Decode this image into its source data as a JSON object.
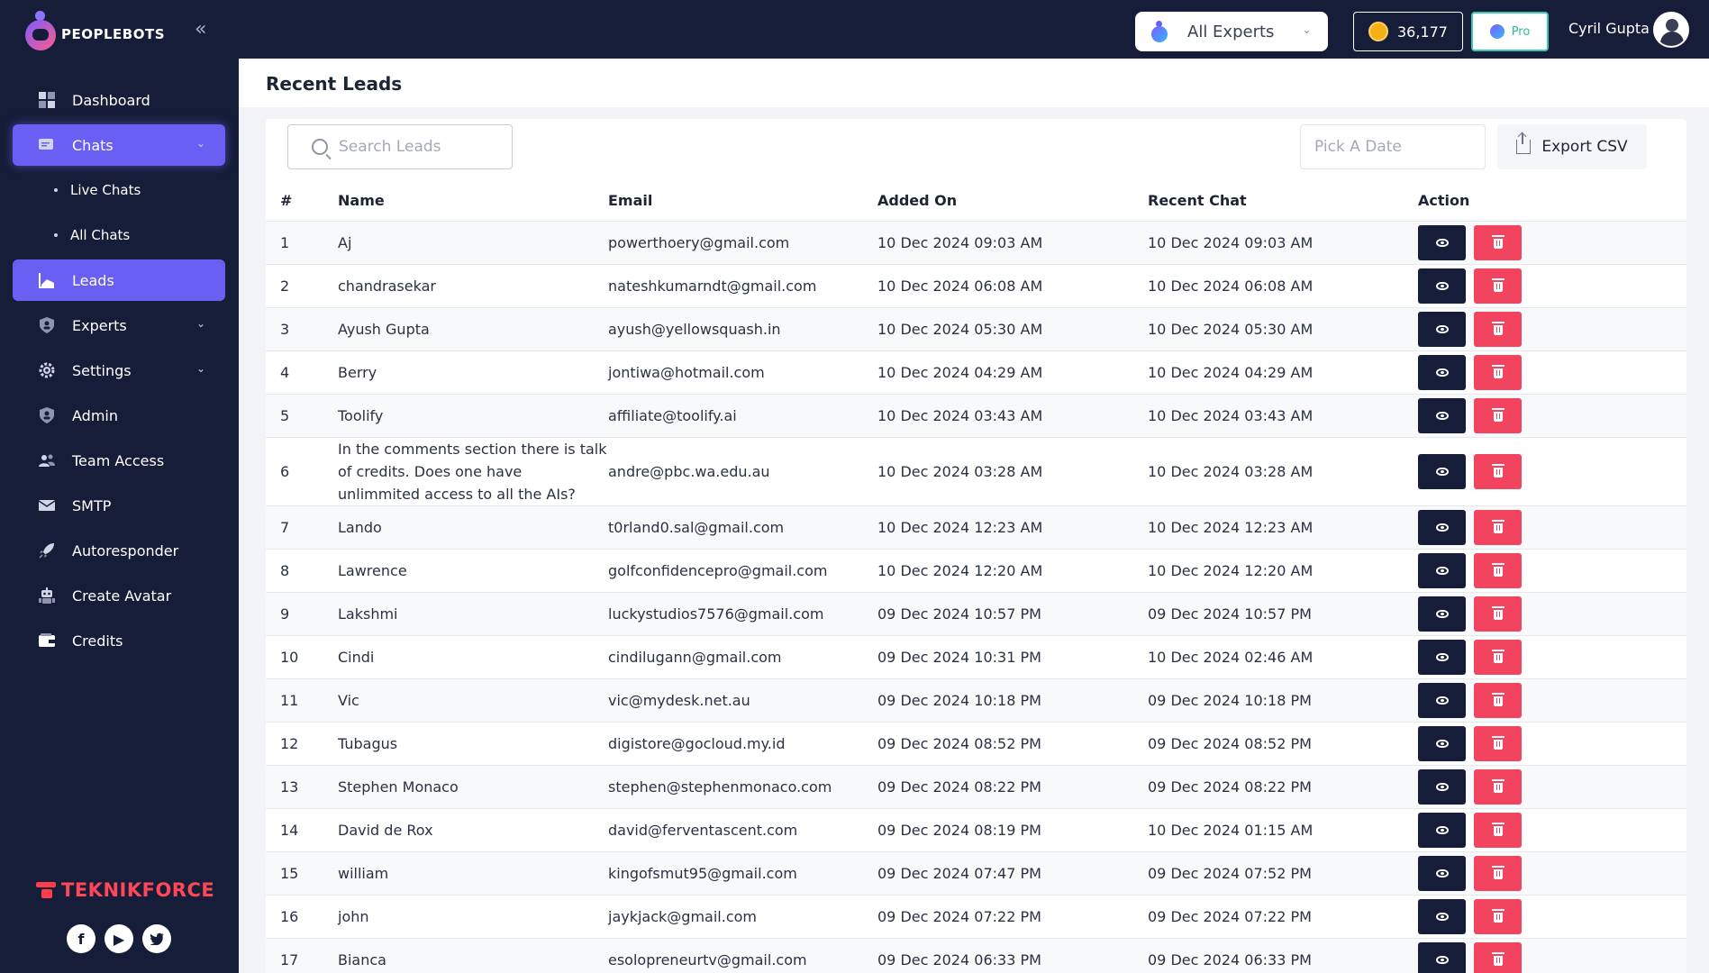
{
  "app": {
    "logo_text": "PEOPLEBOTS",
    "brand_footer": "TEKNIKFORCE"
  },
  "sidebar": {
    "items": [
      {
        "label": "Dashboard"
      },
      {
        "label": "Chats"
      },
      {
        "label": "Live Chats"
      },
      {
        "label": "All Chats"
      },
      {
        "label": "Leads"
      },
      {
        "label": "Experts"
      },
      {
        "label": "Settings"
      },
      {
        "label": "Admin"
      },
      {
        "label": "Team Access"
      },
      {
        "label": "SMTP"
      },
      {
        "label": "Autoresponder"
      },
      {
        "label": "Create Avatar"
      },
      {
        "label": "Credits"
      }
    ]
  },
  "header": {
    "experts_select": "All Experts",
    "credits": "36,177",
    "plan": "Pro",
    "user_name": "Cyril Gupta"
  },
  "main": {
    "page_title": "Recent Leads",
    "search_placeholder": "Search Leads",
    "date_placeholder": "Pick A Date",
    "export_label": "Export CSV",
    "columns": [
      "#",
      "Name",
      "Email",
      "Added On",
      "Recent Chat",
      "Action"
    ],
    "rows": [
      {
        "n": "1",
        "name": "Aj",
        "email": "powerthoery@gmail.com",
        "added": "10 Dec 2024 09:03 AM",
        "recent": "10 Dec 2024 09:03 AM"
      },
      {
        "n": "2",
        "name": "chandrasekar",
        "email": "nateshkumarndt@gmail.com",
        "added": "10 Dec 2024 06:08 AM",
        "recent": "10 Dec 2024 06:08 AM"
      },
      {
        "n": "3",
        "name": "Ayush Gupta",
        "email": "ayush@yellowsquash.in",
        "added": "10 Dec 2024 05:30 AM",
        "recent": "10 Dec 2024 05:30 AM"
      },
      {
        "n": "4",
        "name": "Berry",
        "email": "jontiwa@hotmail.com",
        "added": "10 Dec 2024 04:29 AM",
        "recent": "10 Dec 2024 04:29 AM"
      },
      {
        "n": "5",
        "name": "Toolify",
        "email": "affiliate@toolify.ai",
        "added": "10 Dec 2024 03:43 AM",
        "recent": "10 Dec 2024 03:43 AM"
      },
      {
        "n": "6",
        "name": "In the comments section there is talk of credits. Does one have unlimmited access to all the AIs?",
        "email": "andre@pbc.wa.edu.au",
        "added": "10 Dec 2024 03:28 AM",
        "recent": "10 Dec 2024 03:28 AM"
      },
      {
        "n": "7",
        "name": "Lando",
        "email": "t0rland0.sal@gmail.com",
        "added": "10 Dec 2024 12:23 AM",
        "recent": "10 Dec 2024 12:23 AM"
      },
      {
        "n": "8",
        "name": "Lawrence",
        "email": "golfconfidencepro@gmail.com",
        "added": "10 Dec 2024 12:20 AM",
        "recent": "10 Dec 2024 12:20 AM"
      },
      {
        "n": "9",
        "name": "Lakshmi",
        "email": "luckystudios7576@gmail.com",
        "added": "09 Dec 2024 10:57 PM",
        "recent": "09 Dec 2024 10:57 PM"
      },
      {
        "n": "10",
        "name": "Cindi",
        "email": "cindilugann@gmail.com",
        "added": "09 Dec 2024 10:31 PM",
        "recent": "10 Dec 2024 02:46 AM"
      },
      {
        "n": "11",
        "name": "Vic",
        "email": "vic@mydesk.net.au",
        "added": "09 Dec 2024 10:18 PM",
        "recent": "09 Dec 2024 10:18 PM"
      },
      {
        "n": "12",
        "name": "Tubagus",
        "email": "digistore@gocloud.my.id",
        "added": "09 Dec 2024 08:52 PM",
        "recent": "09 Dec 2024 08:52 PM"
      },
      {
        "n": "13",
        "name": "Stephen Monaco",
        "email": "stephen@stephenmonaco.com",
        "added": "09 Dec 2024 08:22 PM",
        "recent": "09 Dec 2024 08:22 PM"
      },
      {
        "n": "14",
        "name": "David de Rox",
        "email": "david@ferventascent.com",
        "added": "09 Dec 2024 08:19 PM",
        "recent": "10 Dec 2024 01:15 AM"
      },
      {
        "n": "15",
        "name": "william",
        "email": "kingofsmut95@gmail.com",
        "added": "09 Dec 2024 07:47 PM",
        "recent": "09 Dec 2024 07:52 PM"
      },
      {
        "n": "16",
        "name": "john",
        "email": "jaykjack@gmail.com",
        "added": "09 Dec 2024 07:22 PM",
        "recent": "09 Dec 2024 07:22 PM"
      },
      {
        "n": "17",
        "name": "Bianca",
        "email": "esolopreneurtv@gmail.com",
        "added": "09 Dec 2024 06:33 PM",
        "recent": "09 Dec 2024 06:33 PM"
      }
    ]
  }
}
